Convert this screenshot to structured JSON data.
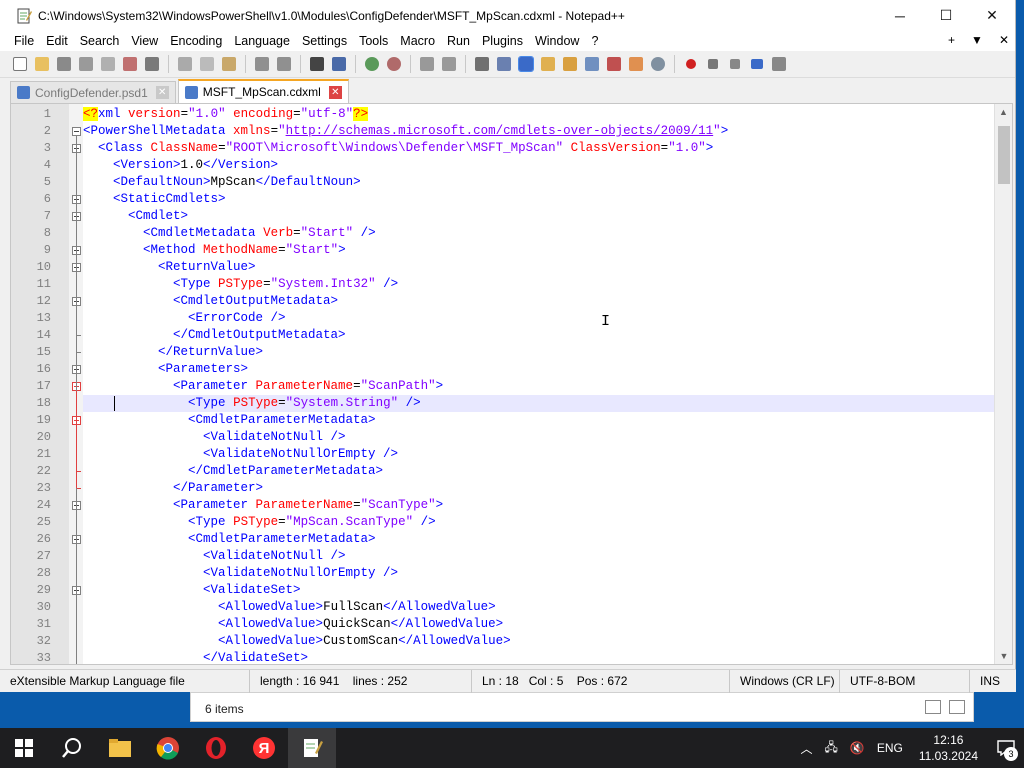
{
  "window": {
    "title": "C:\\Windows\\System32\\WindowsPowerShell\\v1.0\\Modules\\ConfigDefender\\MSFT_MpScan.cdxml - Notepad++",
    "controls": {
      "minimize": "─",
      "maximize": "☐",
      "close": "✕"
    }
  },
  "menu": {
    "items": [
      "File",
      "Edit",
      "Search",
      "View",
      "Encoding",
      "Language",
      "Settings",
      "Tools",
      "Macro",
      "Run",
      "Plugins",
      "Window",
      "?"
    ],
    "right": [
      "+",
      "▼",
      "✕"
    ]
  },
  "tabs": [
    {
      "label": "ConfigDefender.psd1",
      "active": false
    },
    {
      "label": "MSFT_MpScan.cdxml",
      "active": true
    }
  ],
  "editor": {
    "current_line": 18,
    "lines": [
      {
        "n": 1,
        "html": "<span class='t-pi'>&lt;?</span><span class='t-tag'>xml</span> <span class='t-attr'>version</span><span class='t-text'>=</span><span class='t-str'>\"1.0\"</span> <span class='t-attr'>encoding</span><span class='t-text'>=</span><span class='t-str'>\"utf-8\"</span><span class='t-pi'>?&gt;</span>"
      },
      {
        "n": 2,
        "html": "<span class='t-tag'>&lt;PowerShellMetadata</span> <span class='t-attr'>xmlns</span><span class='t-text'>=</span><span class='t-str'>\"</span><span class='t-link'>http://schemas.microsoft.com/cmdlets-over-objects/2009/11</span><span class='t-str'>\"</span><span class='t-tag'>&gt;</span>"
      },
      {
        "n": 3,
        "html": "  <span class='t-tag'>&lt;Class</span> <span class='t-attr'>ClassName</span><span class='t-text'>=</span><span class='t-str'>\"ROOT\\Microsoft\\Windows\\Defender\\MSFT_MpScan\"</span> <span class='t-attr'>ClassVersion</span><span class='t-text'>=</span><span class='t-str'>\"1.0\"</span><span class='t-tag'>&gt;</span>"
      },
      {
        "n": 4,
        "html": "    <span class='t-tag'>&lt;Version&gt;</span><span class='t-text'>1.0</span><span class='t-tag'>&lt;/Version&gt;</span>"
      },
      {
        "n": 5,
        "html": "    <span class='t-tag'>&lt;DefaultNoun&gt;</span><span class='t-text'>MpScan</span><span class='t-tag'>&lt;/DefaultNoun&gt;</span>"
      },
      {
        "n": 6,
        "html": "    <span class='t-tag'>&lt;StaticCmdlets&gt;</span>"
      },
      {
        "n": 7,
        "html": "      <span class='t-tag'>&lt;Cmdlet&gt;</span>"
      },
      {
        "n": 8,
        "html": "        <span class='t-tag'>&lt;CmdletMetadata</span> <span class='t-attr'>Verb</span><span class='t-text'>=</span><span class='t-str'>\"Start\"</span> <span class='t-tag'>/&gt;</span>"
      },
      {
        "n": 9,
        "html": "        <span class='t-tag'>&lt;Method</span> <span class='t-attr'>MethodName</span><span class='t-text'>=</span><span class='t-str'>\"Start\"</span><span class='t-tag'>&gt;</span>"
      },
      {
        "n": 10,
        "html": "          <span class='t-tag'>&lt;ReturnValue&gt;</span>"
      },
      {
        "n": 11,
        "html": "            <span class='t-tag'>&lt;Type</span> <span class='t-attr'>PSType</span><span class='t-text'>=</span><span class='t-str'>\"System.Int32\"</span> <span class='t-tag'>/&gt;</span>"
      },
      {
        "n": 12,
        "html": "            <span class='t-tag'>&lt;CmdletOutputMetadata&gt;</span>"
      },
      {
        "n": 13,
        "html": "              <span class='t-tag'>&lt;ErrorCode /&gt;</span>"
      },
      {
        "n": 14,
        "html": "            <span class='t-tag'>&lt;/CmdletOutputMetadata&gt;</span>"
      },
      {
        "n": 15,
        "html": "          <span class='t-tag'>&lt;/ReturnValue&gt;</span>"
      },
      {
        "n": 16,
        "html": "          <span class='t-tag'>&lt;Parameters&gt;</span>"
      },
      {
        "n": 17,
        "html": "            <span class='t-tag'>&lt;Parameter</span> <span class='t-attr'>ParameterName</span><span class='t-text'>=</span><span class='t-str'>\"ScanPath\"</span><span class='t-tag'>&gt;</span>"
      },
      {
        "n": 18,
        "html": "              <span class='t-tag'>&lt;Type</span> <span class='t-attr'>PSType</span><span class='t-text'>=</span><span class='t-str'>\"System.String\"</span> <span class='t-tag'>/&gt;</span>"
      },
      {
        "n": 19,
        "html": "              <span class='t-tag'>&lt;CmdletParameterMetadata&gt;</span>"
      },
      {
        "n": 20,
        "html": "                <span class='t-tag'>&lt;ValidateNotNull /&gt;</span>"
      },
      {
        "n": 21,
        "html": "                <span class='t-tag'>&lt;ValidateNotNullOrEmpty /&gt;</span>"
      },
      {
        "n": 22,
        "html": "              <span class='t-tag'>&lt;/CmdletParameterMetadata&gt;</span>"
      },
      {
        "n": 23,
        "html": "            <span class='t-tag'>&lt;/Parameter&gt;</span>"
      },
      {
        "n": 24,
        "html": "            <span class='t-tag'>&lt;Parameter</span> <span class='t-attr'>ParameterName</span><span class='t-text'>=</span><span class='t-str'>\"ScanType\"</span><span class='t-tag'>&gt;</span>"
      },
      {
        "n": 25,
        "html": "              <span class='t-tag'>&lt;Type</span> <span class='t-attr'>PSType</span><span class='t-text'>=</span><span class='t-str'>\"MpScan.ScanType\"</span> <span class='t-tag'>/&gt;</span>"
      },
      {
        "n": 26,
        "html": "              <span class='t-tag'>&lt;CmdletParameterMetadata&gt;</span>"
      },
      {
        "n": 27,
        "html": "                <span class='t-tag'>&lt;ValidateNotNull /&gt;</span>"
      },
      {
        "n": 28,
        "html": "                <span class='t-tag'>&lt;ValidateNotNullOrEmpty /&gt;</span>"
      },
      {
        "n": 29,
        "html": "                <span class='t-tag'>&lt;ValidateSet&gt;</span>"
      },
      {
        "n": 30,
        "html": "                  <span class='t-tag'>&lt;AllowedValue&gt;</span><span class='t-text'>FullScan</span><span class='t-tag'>&lt;/AllowedValue&gt;</span>"
      },
      {
        "n": 31,
        "html": "                  <span class='t-tag'>&lt;AllowedValue&gt;</span><span class='t-text'>QuickScan</span><span class='t-tag'>&lt;/AllowedValue&gt;</span>"
      },
      {
        "n": 32,
        "html": "                  <span class='t-tag'>&lt;AllowedValue&gt;</span><span class='t-text'>CustomScan</span><span class='t-tag'>&lt;/AllowedValue&gt;</span>"
      },
      {
        "n": 33,
        "html": "                <span class='t-tag'>&lt;/ValidateSet&gt;</span>"
      }
    ],
    "folds": [
      2,
      3,
      6,
      7,
      9,
      10,
      12,
      16,
      17,
      19,
      24,
      26,
      29
    ],
    "red_folds": [
      17,
      19
    ],
    "fold_ends": [
      14,
      15,
      22,
      23
    ],
    "red_fold_ends": [
      22,
      23
    ]
  },
  "status": {
    "file_type": "eXtensible Markup Language file",
    "length": "length : 16 941",
    "lines": "lines : 252",
    "ln": "Ln : 18",
    "col": "Col : 5",
    "pos": "Pos : 672",
    "eol": "Windows (CR LF)",
    "encoding": "UTF-8-BOM",
    "mode": "INS"
  },
  "behind_window": {
    "status": "6 items"
  },
  "taskbar": {
    "apps": [
      "start-icon",
      "search-icon",
      "file-explorer-icon",
      "chrome-icon",
      "opera-icon",
      "yandex-icon",
      "notepadpp-icon"
    ],
    "tray": {
      "language": "ENG",
      "time": "12:16",
      "date": "11.03.2024",
      "notifications": "3"
    }
  },
  "colors": {
    "tag": "#0000ff",
    "attr": "#ff0000",
    "string": "#8000ff",
    "current_line": "#e8e8ff",
    "tab_accent": "#f5a623",
    "taskbar": "#1e1e20",
    "desktop": "#0a5bab"
  }
}
